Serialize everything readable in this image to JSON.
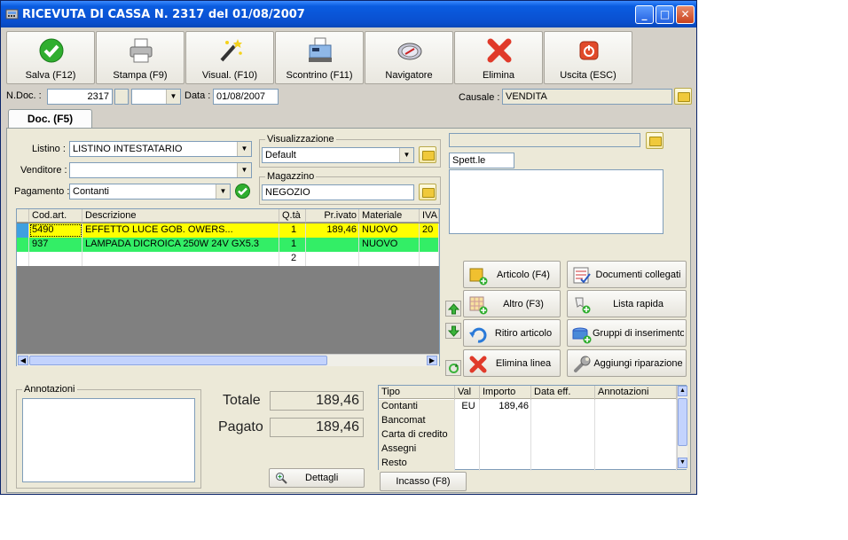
{
  "window": {
    "title": "RICEVUTA DI CASSA N.  2317   del 01/08/2007"
  },
  "toolbar": [
    {
      "label": "Salva (F12)",
      "icon": "check-circle-icon"
    },
    {
      "label": "Stampa (F9)",
      "icon": "printer-icon"
    },
    {
      "label": "Visual. (F10)",
      "icon": "magic-wand-icon"
    },
    {
      "label": "Scontrino (F11)",
      "icon": "cash-register-icon"
    },
    {
      "label": "Navigatore",
      "icon": "navigator-icon"
    },
    {
      "label": "Elimina",
      "icon": "delete-x-icon"
    },
    {
      "label": "Uscita (ESC)",
      "icon": "power-icon"
    }
  ],
  "header": {
    "ndoc_label": "N.Doc. :",
    "ndoc_value": "2317",
    "data_label": "Data :",
    "data_value": "01/08/2007",
    "causale_label": "Causale :",
    "causale_value": "VENDITA"
  },
  "tab": {
    "label": "Doc. (F5)"
  },
  "form": {
    "listino_label": "Listino :",
    "listino_value": "LISTINO INTESTATARIO",
    "venditore_label": "Venditore :",
    "venditore_value": "",
    "pagamento_label": "Pagamento :",
    "pagamento_value": "Contanti",
    "visualizzazione_label": "Visualizzazione",
    "visualizzazione_value": "Default",
    "magazzino_label": "Magazzino",
    "magazzino_value": "NEGOZIO",
    "cliente_value": "",
    "spett_value": "Spett.le"
  },
  "grid": {
    "columns": [
      "Cod.art.",
      "Descrizione",
      "Q.tà",
      "Pr.ivato",
      "Materiale",
      "IVA"
    ],
    "rows": [
      [
        "5490",
        "EFFETTO LUCE              GOB.      OWERS...",
        "1",
        "189,46",
        "NUOVO",
        "20"
      ],
      [
        "937",
        "LAMPADA DICROICA 250W 24V GX5.3",
        "1",
        "",
        "NUOVO",
        ""
      ],
      [
        "",
        "",
        "2",
        "",
        "",
        ""
      ]
    ]
  },
  "actions": [
    {
      "label": "Articolo (F4)",
      "icon": "add-article-icon"
    },
    {
      "label": "Documenti collegati",
      "icon": "linked-docs-icon"
    },
    {
      "label": "Altro (F3)",
      "icon": "add-other-icon"
    },
    {
      "label": "Lista rapida",
      "icon": "quick-list-icon"
    },
    {
      "label": "Ritiro articolo",
      "icon": "undo-icon"
    },
    {
      "label": "Gruppi di inserimento",
      "icon": "insert-groups-icon"
    },
    {
      "label": "Elimina linea",
      "icon": "delete-line-icon"
    },
    {
      "label": "Aggiungi riparazione",
      "icon": "wrench-icon"
    }
  ],
  "notes": {
    "label": "Annotazioni"
  },
  "totals": {
    "totale_label": "Totale",
    "totale_value": "189,46",
    "pagato_label": "Pagato",
    "pagato_value": "189,46",
    "dettagli_label": "Dettagli"
  },
  "payments": {
    "columns": [
      "Tipo",
      "Val",
      "Importo",
      "Data eff.",
      "Annotazioni"
    ],
    "rows": [
      [
        "Contanti",
        "EU",
        "189,46",
        "",
        ""
      ],
      [
        "Bancomat",
        "",
        "",
        "",
        ""
      ],
      [
        "Carta di credito",
        "",
        "",
        "",
        ""
      ],
      [
        "Assegni",
        "",
        "",
        "",
        ""
      ],
      [
        "Resto",
        "",
        "",
        "",
        ""
      ]
    ],
    "incasso_label": "Incasso (F8)"
  },
  "colors": {
    "row_selected": "#ffff00",
    "row_green": "#33ee66",
    "title_blue": "#0a4fcf"
  }
}
